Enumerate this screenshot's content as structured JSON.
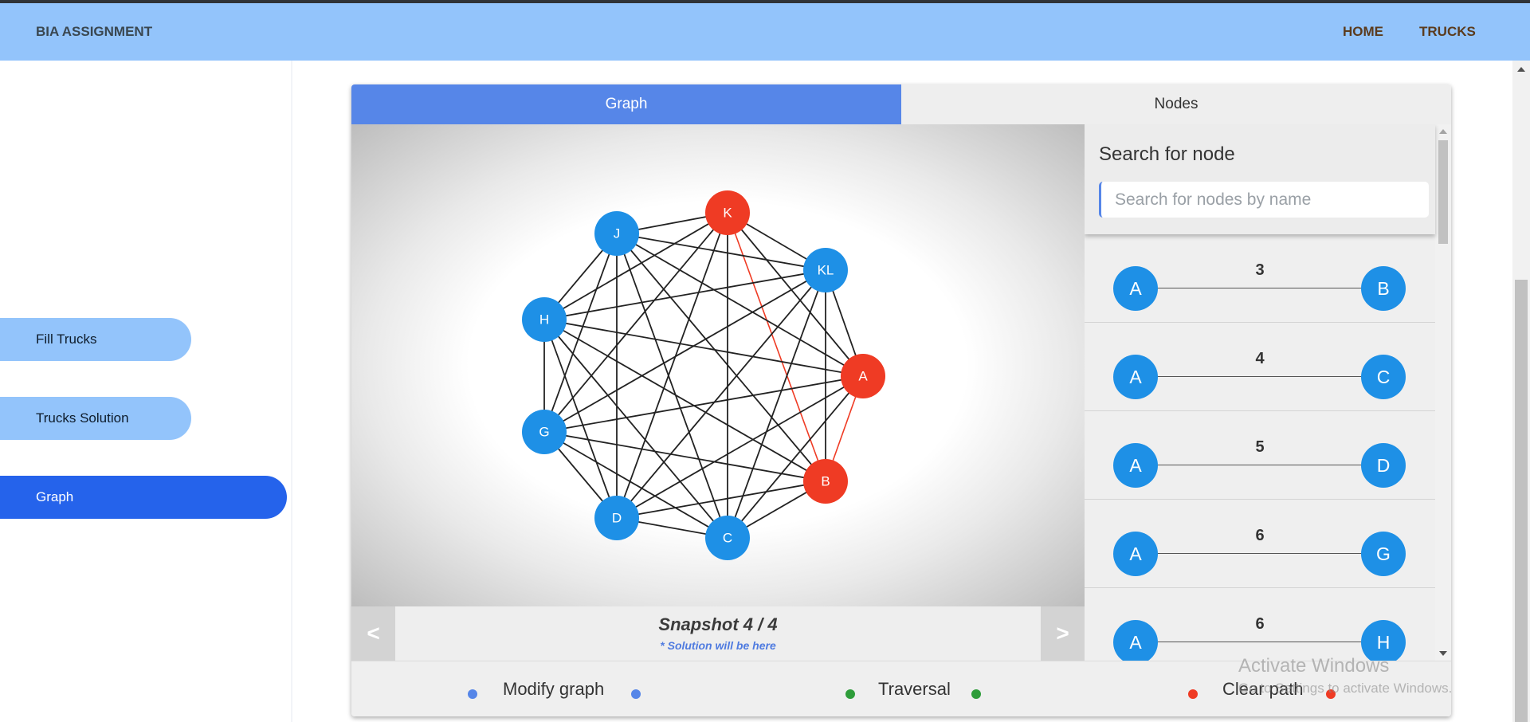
{
  "navbar": {
    "brand": "BIA ASSIGNMENT",
    "home": "HOME",
    "trucks": "TRUCKS"
  },
  "sidebar": {
    "items": [
      {
        "label": "Fill Trucks",
        "active": false
      },
      {
        "label": "Trucks Solution",
        "active": false
      },
      {
        "label": "Graph",
        "active": true
      }
    ]
  },
  "tabs": [
    {
      "label": "Graph",
      "active": true
    },
    {
      "label": "Nodes",
      "active": false
    }
  ],
  "graph": {
    "nodes": [
      {
        "id": "K",
        "color": "#ef3b24"
      },
      {
        "id": "KL",
        "color": "#1e90e6"
      },
      {
        "id": "A",
        "color": "#ef3b24"
      },
      {
        "id": "B",
        "color": "#ef3b24"
      },
      {
        "id": "C",
        "color": "#1e90e6"
      },
      {
        "id": "D",
        "color": "#1e90e6"
      },
      {
        "id": "G",
        "color": "#1e90e6"
      },
      {
        "id": "H",
        "color": "#1e90e6"
      },
      {
        "id": "J",
        "color": "#1e90e6"
      }
    ],
    "edge_color": "#222222",
    "highlight_color": "#ef3b24",
    "highlighted_edges": [
      [
        "K",
        "B"
      ],
      [
        "A",
        "B"
      ]
    ]
  },
  "snapshot": {
    "prev": "<",
    "next": ">",
    "title": "Snapshot 4 / 4",
    "subtitle": "* Solution will be here"
  },
  "nodes_panel": {
    "search_title": "Search for node",
    "search_placeholder": "Search for nodes by name",
    "edges": [
      {
        "from": "A",
        "to": "B",
        "weight": "3"
      },
      {
        "from": "A",
        "to": "C",
        "weight": "4"
      },
      {
        "from": "A",
        "to": "D",
        "weight": "5"
      },
      {
        "from": "A",
        "to": "G",
        "weight": "6"
      },
      {
        "from": "A",
        "to": "H",
        "weight": "6"
      }
    ]
  },
  "legend": {
    "items": [
      {
        "label": "Modify graph",
        "color": "#5686e8"
      },
      {
        "label": "Traversal",
        "color": "#2e9d3a"
      },
      {
        "label": "Clear path",
        "color": "#ef3b24"
      }
    ]
  },
  "watermark": {
    "line1": "Activate Windows",
    "line2": "Go to Settings to activate Windows."
  }
}
